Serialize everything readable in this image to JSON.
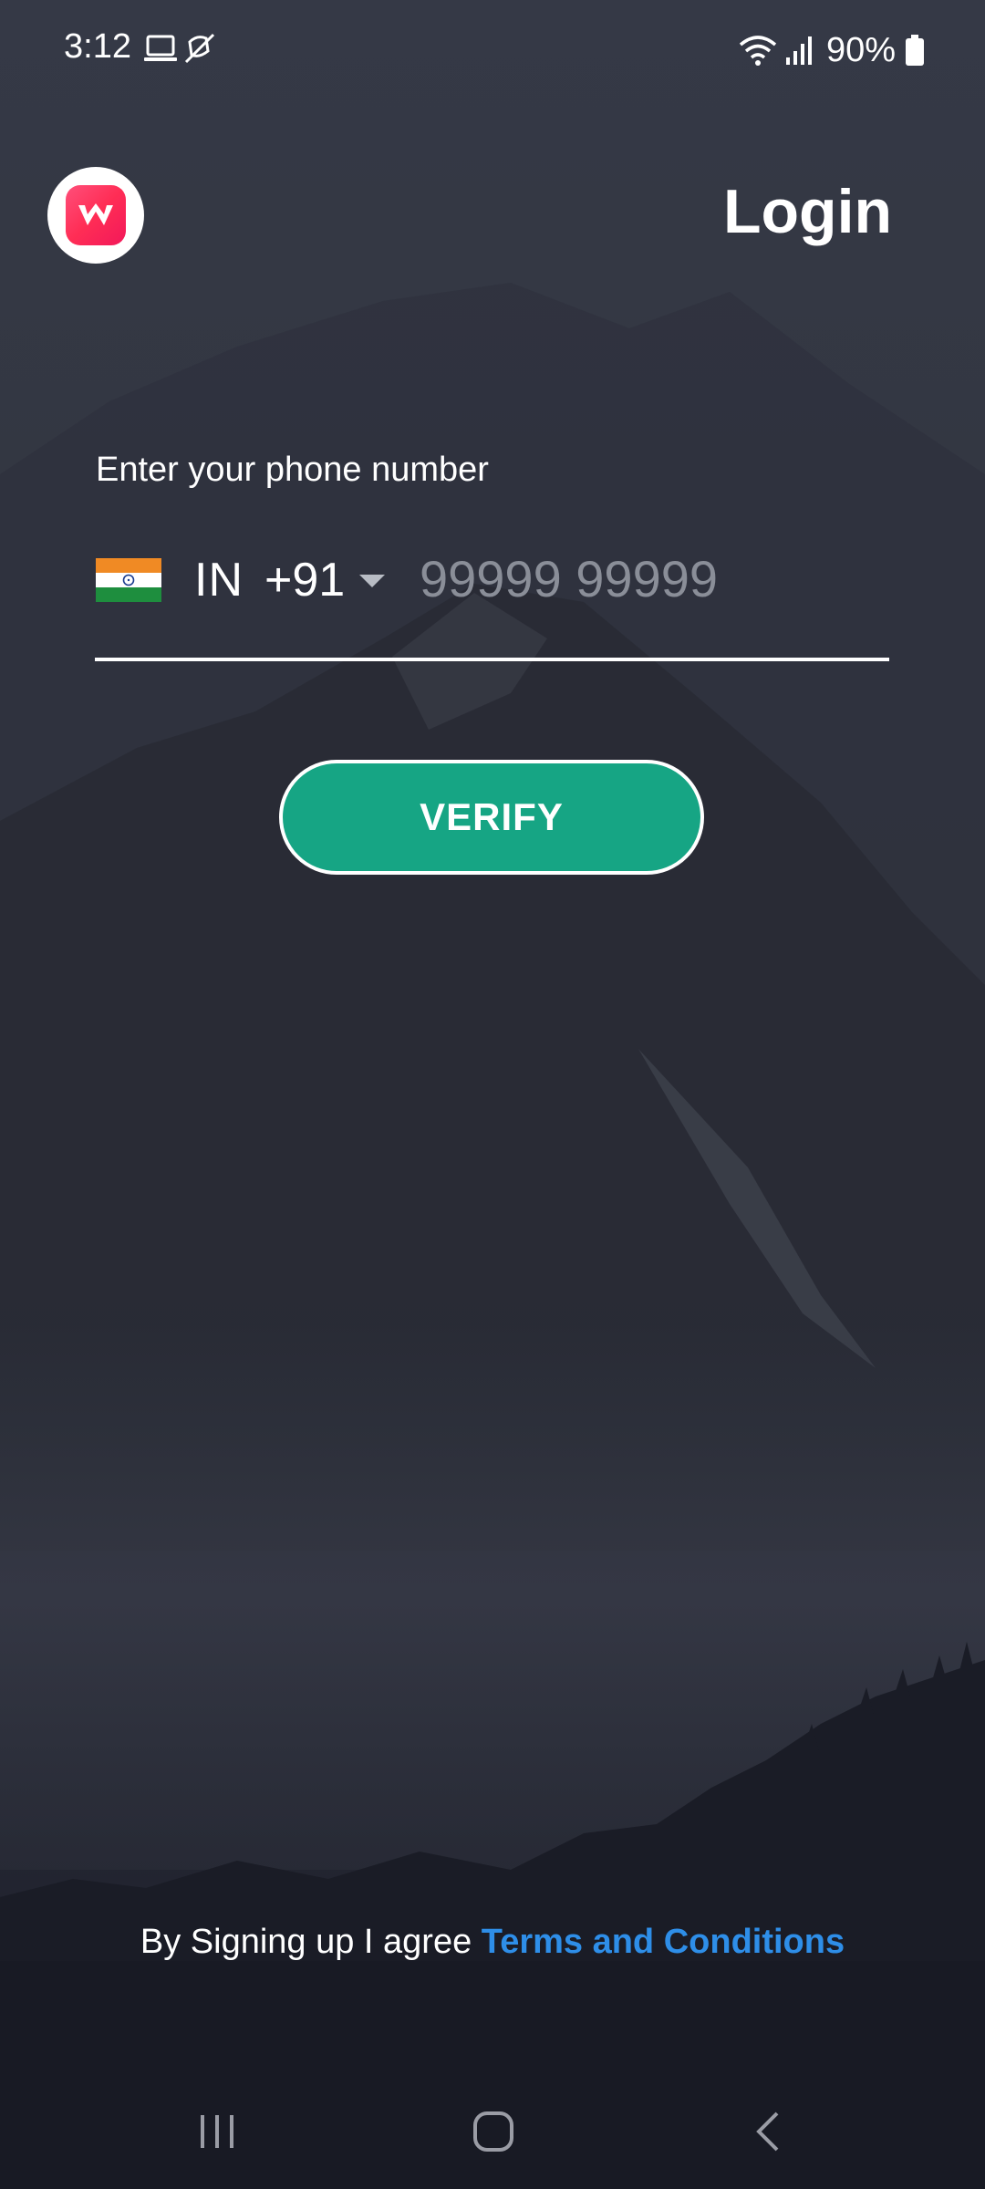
{
  "status_bar": {
    "time": "3:12",
    "battery": "90%",
    "icons": [
      "laptop-icon",
      "mute-icon",
      "wifi-icon",
      "signal-icon",
      "battery-icon"
    ]
  },
  "header": {
    "title": "Login",
    "logo_icon": "app-logo-icon"
  },
  "phone": {
    "label": "Enter your phone number",
    "country": "IN",
    "dial_code": "+91",
    "flag_icon": "india-flag-icon",
    "placeholder": "99999 99999",
    "value": ""
  },
  "verify_button": {
    "label": "VERIFY"
  },
  "terms": {
    "prefix": "By Signing up I agree",
    "link": "Terms and Conditions"
  },
  "colors": {
    "accent_button": "#16a584",
    "link": "#2e8ee8",
    "logo": "#ff2d55"
  }
}
